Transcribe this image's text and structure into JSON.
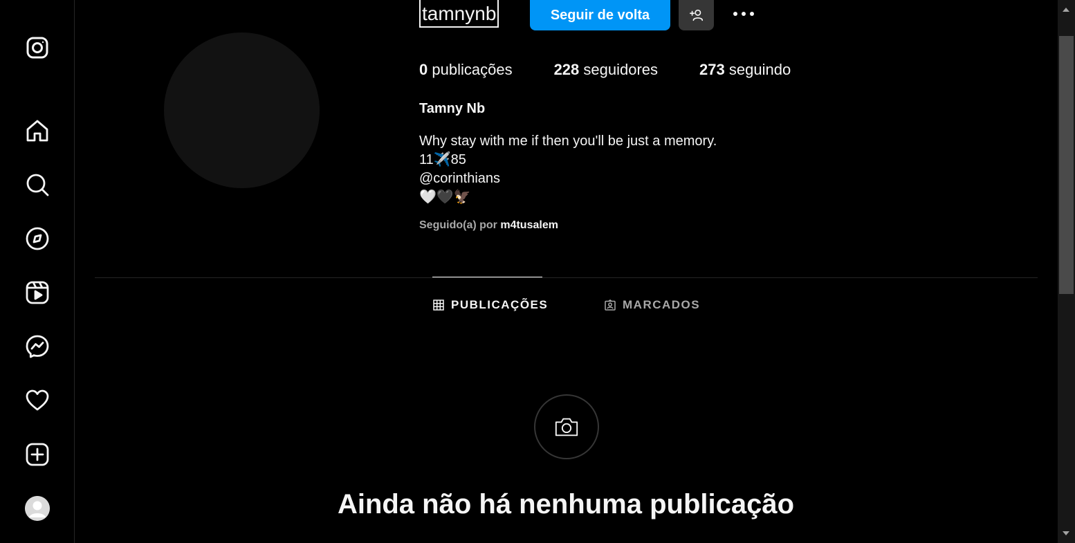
{
  "sidebar": {
    "items": [
      {
        "name": "instagram-logo-icon"
      },
      {
        "name": "home-icon",
        "label": "Página inicial"
      },
      {
        "name": "search-icon",
        "label": "Pesquisa"
      },
      {
        "name": "explore-icon",
        "label": "Explorar"
      },
      {
        "name": "reels-icon",
        "label": "Reels"
      },
      {
        "name": "messenger-icon",
        "label": "Mensagens"
      },
      {
        "name": "heart-icon",
        "label": "Notificações"
      },
      {
        "name": "create-icon",
        "label": "Criar"
      },
      {
        "name": "profile-avatar",
        "label": "Perfil"
      }
    ]
  },
  "profile": {
    "username": "tamnynb",
    "follow_button": "Seguir de volta",
    "stats": {
      "posts_count": "0",
      "posts_label": "publicações",
      "followers_count": "228",
      "followers_label": "seguidores",
      "following_count": "273",
      "following_label": "seguindo"
    },
    "full_name": "Tamny Nb",
    "bio": [
      "Why stay with me if then you'll be just a memory.",
      "11✈️85",
      "@corinthians",
      "🤍🖤🦅"
    ],
    "followed_by_prefix": "Seguido(a) por",
    "followed_by_user": "m4tusalem"
  },
  "tabs": {
    "posts": "PUBLICAÇÕES",
    "tagged": "MARCADOS"
  },
  "empty_state": {
    "title": "Ainda não há nenhuma publicação"
  },
  "colors": {
    "background": "#000000",
    "accent": "#0095f6",
    "secondary_button": "#363636"
  }
}
